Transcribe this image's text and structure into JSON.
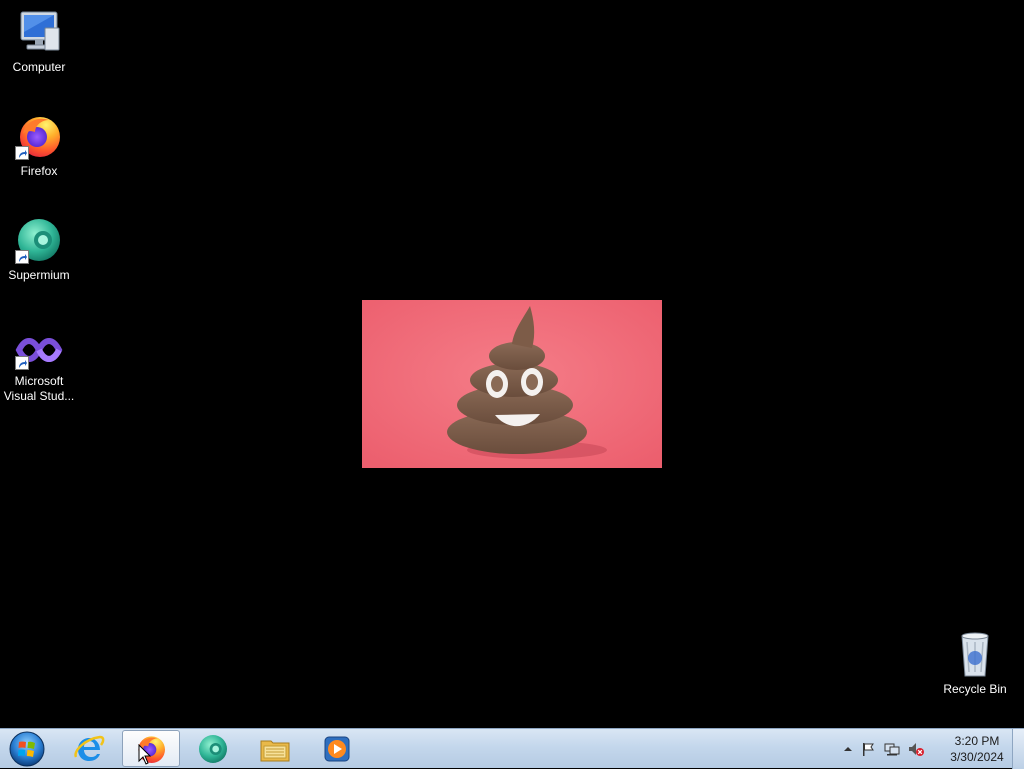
{
  "desktop": {
    "background_color": "#000000",
    "icons": [
      {
        "label": "Computer",
        "icon": "computer-icon",
        "shortcut": false
      },
      {
        "label": "Firefox",
        "icon": "firefox-icon",
        "shortcut": true
      },
      {
        "label": "Supermium",
        "icon": "supermium-icon",
        "shortcut": true
      },
      {
        "label": "Microsoft Visual Stud...",
        "icon": "visual-studio-icon",
        "shortcut": true
      },
      {
        "label": "Recycle Bin",
        "icon": "recycle-bin-icon",
        "shortcut": false
      }
    ],
    "wallpaper_image": {
      "subject": "poop-emoji-figure",
      "background_color": "#f1707c"
    }
  },
  "taskbar": {
    "start_icon": "windows-start-icon",
    "pinned": [
      {
        "name": "internet-explorer",
        "icon": "internet-explorer-icon",
        "active": false
      },
      {
        "name": "firefox",
        "icon": "firefox-icon",
        "active": true
      },
      {
        "name": "supermium",
        "icon": "supermium-icon",
        "active": false
      },
      {
        "name": "file-explorer",
        "icon": "folder-icon",
        "active": false
      },
      {
        "name": "media-player",
        "icon": "media-player-icon",
        "active": false
      }
    ],
    "tray": {
      "icons": [
        "show-hidden-icons-icon",
        "action-center-flag-icon",
        "network-icon",
        "volume-muted-icon"
      ],
      "time": "3:20 PM",
      "date": "3/30/2024"
    }
  }
}
